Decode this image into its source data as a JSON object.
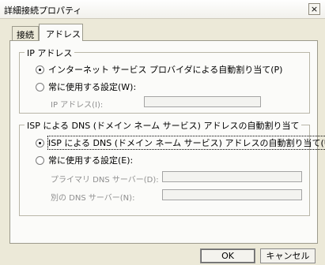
{
  "window": {
    "title": "詳細接続プロパティ",
    "close_glyph": "×"
  },
  "tabs": [
    {
      "label": "接続",
      "active": false
    },
    {
      "label": "アドレス",
      "active": true
    }
  ],
  "ip_group": {
    "legend": "IP アドレス",
    "options": [
      {
        "label": "インターネット サービス プロバイダによる自動割り当て(P)",
        "selected": true
      },
      {
        "label": "常に使用する設定(W):",
        "selected": false
      }
    ],
    "ip_field": {
      "label": "IP アドレス(I):",
      "value": ""
    }
  },
  "dns_group": {
    "legend": "ISP による DNS (ドメイン ネーム サービス) アドレスの自動割り当て",
    "options": [
      {
        "label": "ISP による DNS (ドメイン ネーム サービス) アドレスの自動割り当て(U)",
        "selected": true
      },
      {
        "label": "常に使用する設定(E):",
        "selected": false
      }
    ],
    "primary_dns": {
      "label": "プライマリ DNS サーバー(D):",
      "value": ""
    },
    "alternate_dns": {
      "label": "別の DNS サーバー(N):",
      "value": ""
    }
  },
  "buttons": {
    "ok": "OK",
    "cancel": "キャンセル"
  }
}
